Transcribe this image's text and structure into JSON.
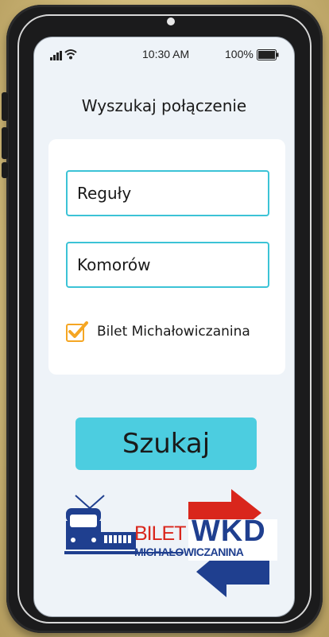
{
  "status_bar": {
    "time": "10:30 AM",
    "battery_text": "100%",
    "icons": [
      "signal-icon",
      "wifi-icon",
      "battery-icon"
    ]
  },
  "page": {
    "title": "Wyszukaj połączenie"
  },
  "form": {
    "from_value": "Reguły",
    "to_value": "Komorów",
    "checkbox_label": "Bilet Michałowiczanina",
    "checkbox_checked": true
  },
  "actions": {
    "search_label": "Szukaj"
  },
  "logo": {
    "bilet_text": "BILET",
    "wkd_text": "WKD",
    "michalowiczanina_text": "MICHAŁOWICZANINA"
  },
  "colors": {
    "accent": "#4ccde0",
    "field_border": "#3cc3d6",
    "checkbox": "#f5a623",
    "brand_blue": "#1f3f8f",
    "brand_red": "#d9261c",
    "screen_bg": "#eef3f8"
  }
}
